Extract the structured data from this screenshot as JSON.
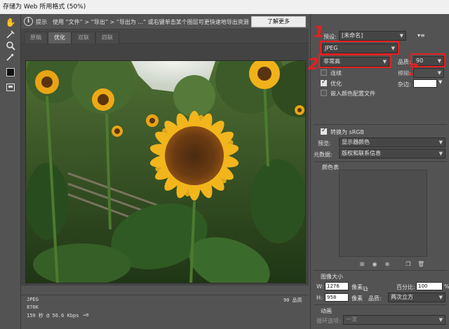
{
  "window": {
    "title": "存储为 Web 所用格式 (50%)"
  },
  "infobar": {
    "label": "提示",
    "text": "使用 “文件” > “导出” > “导出为 ...” 或右键单击某个图层可更快速地导出资源",
    "learn_more": "了解更多"
  },
  "tabs": [
    {
      "label": "原稿",
      "active": false
    },
    {
      "label": "优化",
      "active": true
    },
    {
      "label": "双联",
      "active": false
    },
    {
      "label": "四联",
      "active": false
    }
  ],
  "image_info": {
    "format": "JPEG",
    "size": "876K",
    "speed": "159 秒 @ 56.6 Kbps",
    "speed_menu": "→≡",
    "quality": "90 品质"
  },
  "settings": {
    "preset_label": "预设:",
    "preset_value": "[未命名]",
    "format_value": "JPEG",
    "quality_level": "非常高",
    "quality_label": "品质:",
    "quality_value": "90",
    "progressive_label": "连续",
    "blur_label": "模糊:",
    "optimized_label": "优化",
    "matte_label": "杂边:",
    "embed_profile_label": "嵌入颜色配置文件",
    "convert_srgb_label": "转换为 sRGB",
    "preview_label": "预览:",
    "preview_value": "显示器颜色",
    "metadata_label": "元数据:",
    "metadata_value": "版权和联系信息",
    "color_table_label": "颜色表",
    "annotations": [
      "1",
      "2",
      "3"
    ],
    "checks": {
      "progressive": false,
      "optimized": true,
      "embed_profile": false,
      "convert_srgb": true
    }
  },
  "image_size": {
    "heading": "图像大小",
    "w_label": "W:",
    "w_value": "1276",
    "h_label": "H:",
    "h_value": "958",
    "unit": "像素",
    "percent_label": "百分比:",
    "percent_value": "100",
    "percent_unit": "%",
    "quality_label": "品质:",
    "quality_value": "两次立方"
  },
  "animation": {
    "heading": "动画",
    "loop_label": "循环选项:",
    "loop_value": "一次"
  },
  "colors": {
    "accent_red": "#e52020",
    "panel_bg": "#535353"
  },
  "icons": [
    "hand-icon",
    "slice-select-icon",
    "zoom-icon",
    "eyedropper-icon",
    "eyedropper-color-swatch",
    "toggle-slices-icon",
    "info-icon"
  ]
}
